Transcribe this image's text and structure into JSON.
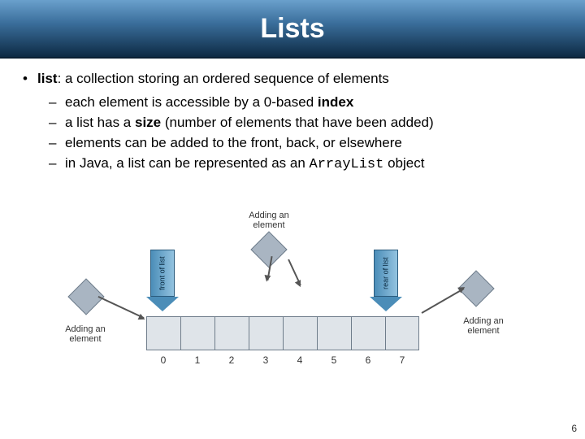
{
  "title": "Lists",
  "bullet": {
    "term": "list",
    "definition": ": a collection storing an ordered sequence of elements"
  },
  "sub_items": [
    {
      "pre": "each element is accessible by a 0-based ",
      "bold": "index",
      "post": ""
    },
    {
      "pre": "a list has a ",
      "bold": "size",
      "post": " (number of elements that have been added)"
    },
    {
      "pre": "elements can be added to the front, back, or elsewhere",
      "bold": "",
      "post": ""
    },
    {
      "pre": "in Java, a list can be represented as an ",
      "code": "ArrayList",
      "post": " object"
    }
  ],
  "diagram": {
    "indices": [
      "0",
      "1",
      "2",
      "3",
      "4",
      "5",
      "6",
      "7"
    ],
    "front_label": "front of list",
    "rear_label": "rear of list",
    "add_caption": "Adding an\nelement"
  },
  "page_number": "6"
}
